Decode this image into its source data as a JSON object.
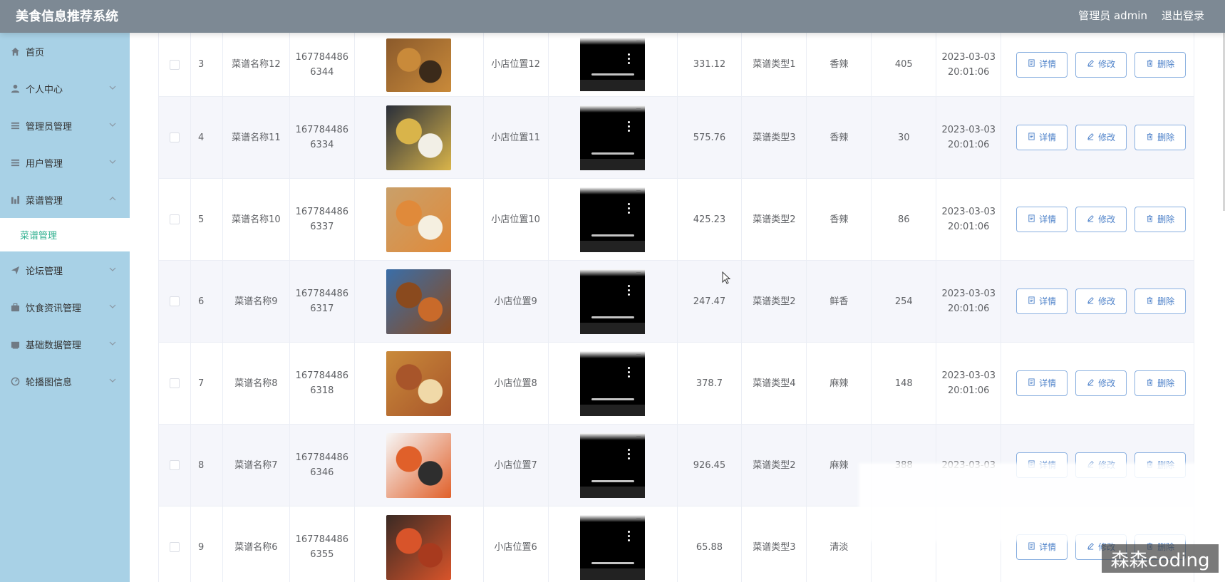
{
  "header": {
    "title": "美食信息推荐系统",
    "user": "管理员 admin",
    "logout": "退出登录"
  },
  "sidebar": {
    "items": [
      {
        "label": "首页",
        "icon": "home-icon"
      },
      {
        "label": "个人中心",
        "icon": "user-icon"
      },
      {
        "label": "管理员管理",
        "icon": "list-icon"
      },
      {
        "label": "用户管理",
        "icon": "list-icon"
      },
      {
        "label": "菜谱管理",
        "icon": "chart-icon",
        "expanded": true
      },
      {
        "label": "论坛管理",
        "icon": "send-icon"
      },
      {
        "label": "饮食资讯管理",
        "icon": "briefcase-icon"
      },
      {
        "label": "基础数据管理",
        "icon": "folder-icon"
      },
      {
        "label": "轮播图信息",
        "icon": "gauge-icon"
      }
    ],
    "submenu_active": "菜谱管理"
  },
  "table": {
    "buttons": {
      "detail": "详情",
      "edit": "修改",
      "delete": "删除"
    },
    "rows": [
      {
        "index": "3",
        "name": "菜谱名称12",
        "id_line1": "167784486",
        "id_line2": "6344",
        "location": "小店位置12",
        "price": "331.12",
        "type": "菜谱类型1",
        "taste": "香辣",
        "count": "405",
        "date": "2023-03-03",
        "time": "20:01:06"
      },
      {
        "index": "4",
        "name": "菜谱名称11",
        "id_line1": "167784486",
        "id_line2": "6334",
        "location": "小店位置11",
        "price": "575.76",
        "type": "菜谱类型3",
        "taste": "香辣",
        "count": "30",
        "date": "2023-03-03",
        "time": "20:01:06"
      },
      {
        "index": "5",
        "name": "菜谱名称10",
        "id_line1": "167784486",
        "id_line2": "6337",
        "location": "小店位置10",
        "price": "425.23",
        "type": "菜谱类型2",
        "taste": "香辣",
        "count": "86",
        "date": "2023-03-03",
        "time": "20:01:06"
      },
      {
        "index": "6",
        "name": "菜谱名称9",
        "id_line1": "167784486",
        "id_line2": "6317",
        "location": "小店位置9",
        "price": "247.47",
        "type": "菜谱类型2",
        "taste": "鲜香",
        "count": "254",
        "date": "2023-03-03",
        "time": "20:01:06"
      },
      {
        "index": "7",
        "name": "菜谱名称8",
        "id_line1": "167784486",
        "id_line2": "6318",
        "location": "小店位置8",
        "price": "378.7",
        "type": "菜谱类型4",
        "taste": "麻辣",
        "count": "148",
        "date": "2023-03-03",
        "time": "20:01:06"
      },
      {
        "index": "8",
        "name": "菜谱名称7",
        "id_line1": "167784486",
        "id_line2": "6346",
        "location": "小店位置7",
        "price": "926.45",
        "type": "菜谱类型2",
        "taste": "麻辣",
        "count": "388",
        "date": "2023-03-03",
        "time": ""
      },
      {
        "index": "9",
        "name": "菜谱名称6",
        "id_line1": "167784486",
        "id_line2": "6355",
        "location": "小店位置6",
        "price": "65.88",
        "type": "菜谱类型3",
        "taste": "清淡",
        "count": "",
        "date": "",
        "time": ""
      }
    ]
  },
  "watermark": "森森coding"
}
